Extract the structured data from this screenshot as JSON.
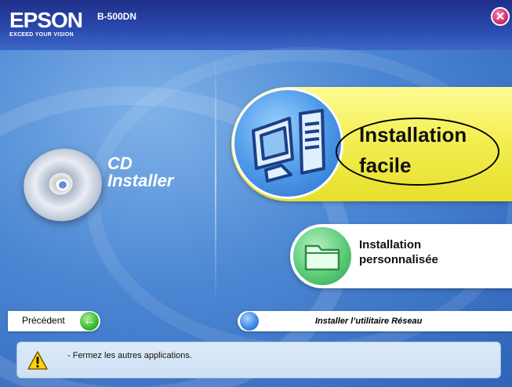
{
  "header": {
    "brand": "EPSON",
    "tagline": "EXCEED YOUR VISION",
    "model": "B-500DN",
    "close_glyph": "✕"
  },
  "left": {
    "product_title_line1": "CD",
    "product_title_line2": "Installer",
    "cd_icon": "cd-disc-icon"
  },
  "options": {
    "easy_install": {
      "line1": "Installation",
      "line2": "facile",
      "icon": "computer-icon"
    },
    "custom_install": {
      "line1": "Installation",
      "line2": "personnalisée",
      "icon": "folder-icon"
    }
  },
  "footer": {
    "back_label": "Précédent",
    "back_glyph": "←",
    "network_label": "Installer l’utilitaire Réseau"
  },
  "message": {
    "icon": "warning-icon",
    "text": "- Fermez les autres applications."
  },
  "colors": {
    "header": "#1e2f88",
    "background": "#4b86d3",
    "easy_panel": "#f4ef53",
    "close": "#d0306f",
    "back_arrow": "#38b832"
  }
}
